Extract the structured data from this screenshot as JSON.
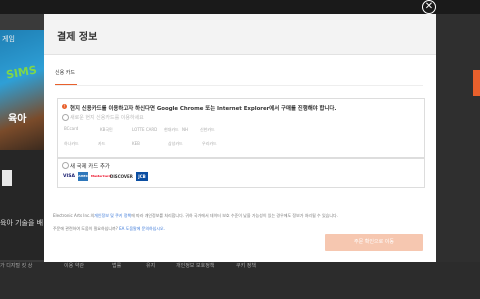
{
  "modal": {
    "title": "결제 정보",
    "tab_label": "신용 카드",
    "warning": "현지 신용카드를 이용하고자 하신다면 Google Chrome 또는 Internet Explorer에서 구매를 진행해야 합니다.",
    "local_card_label": "새로운 현지 신용카드를 이용하세요",
    "local_card_logos": [
      "BCcard",
      "KB국민",
      "LOTTE CARD",
      "현대카드",
      "NH",
      "신한카드",
      "하나카드",
      "카드",
      "KEB",
      "삼성카드",
      "우리카드"
    ],
    "add_card_label": "새 국제 카드 추가",
    "payment_logos": [
      "VISA",
      "AMEX",
      "MasterCard",
      "DISCOVER",
      "JCB"
    ],
    "notice_prefix": "Electronic Arts Inc.의",
    "notice_link": "개인정보 및 쿠키 정책",
    "notice_suffix": "에 따라 개인정보를 처리합니다. 귀하 국가에서 데이터 보호 수준이 낮을 가능성이 있는 경우에도 정보가 처리될 수 있습니다.",
    "help_prefix": "주문에 관련하여 도움이 필요하십니까?",
    "help_link": "EA 도움말에 문의하십시오.",
    "submit_label": "주문 확인으로 이동"
  },
  "background": {
    "game_label": "게임",
    "product_name": "육아",
    "skill_text": "육아 기술을 배",
    "footer_items": [
      "가 디지털 킷 상",
      "이용 약관",
      "법률",
      "유지",
      "개인정보 보호정책",
      "쿠키 정책"
    ]
  },
  "colors": {
    "accent": "#e8602c",
    "submit_disabled": "#f6c7b0"
  }
}
